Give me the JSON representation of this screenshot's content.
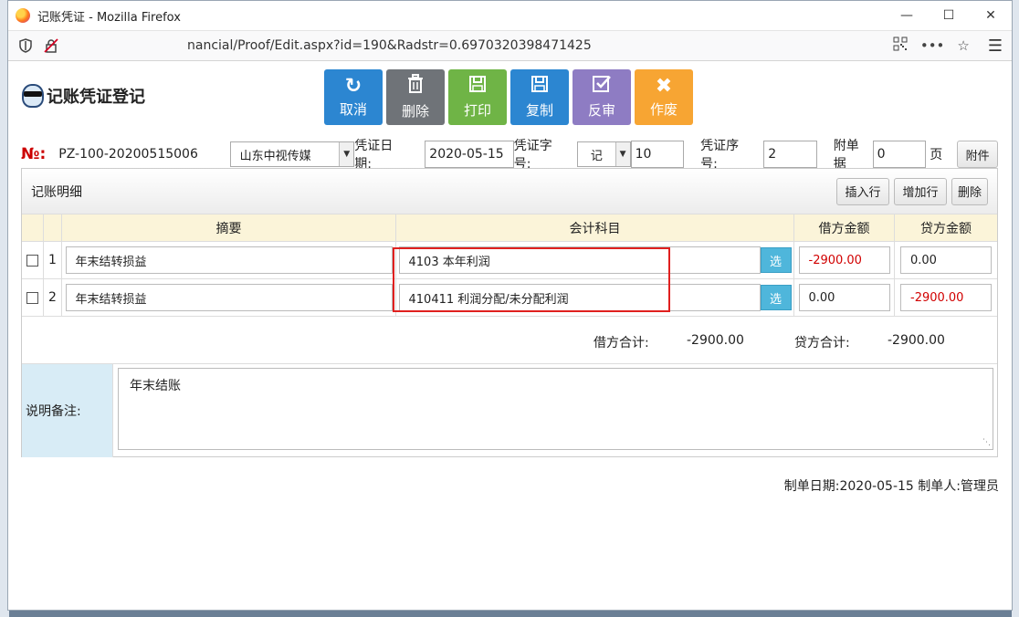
{
  "window": {
    "title": "记账凭证 - Mozilla Firefox",
    "url": "nancial/Proof/Edit.aspx?id=190&Radstr=0.6970320398471425"
  },
  "page": {
    "title": "记账凭证登记",
    "toolbar": {
      "cancel": "取消",
      "delete": "删除",
      "print": "打印",
      "copy": "复制",
      "unaudit": "反审",
      "void": "作废"
    },
    "no_mark": "№:",
    "voucher_no": "PZ-100-20200515006",
    "company": "山东中视传媒",
    "date_label": "凭证日期:",
    "date_value": "2020-05-15",
    "word_label": "凭证字号:",
    "word_value": "记",
    "word_num": "10",
    "seq_label": "凭证序号:",
    "seq_value": "2",
    "attach_label": "附单据",
    "attach_value": "0",
    "attach_unit": "页",
    "attach_button": "附件"
  },
  "detail": {
    "title": "记账明细",
    "insert_row": "插入行",
    "add_row": "增加行",
    "delete": "删除",
    "headers": {
      "summary": "摘要",
      "subject": "会计科目",
      "debit": "借方金额",
      "credit": "贷方金额"
    },
    "select_label": "选",
    "rows": [
      {
        "no": "1",
        "summary": "年末结转损益",
        "subject": "4103 本年利润",
        "debit": "-2900.00",
        "credit": "0.00"
      },
      {
        "no": "2",
        "summary": "年末结转损益",
        "subject": "410411 利润分配/未分配利润",
        "debit": "0.00",
        "credit": "-2900.00"
      }
    ],
    "debit_total_label": "借方合计:",
    "debit_total": "-2900.00",
    "credit_total_label": "贷方合计:",
    "credit_total": "-2900.00",
    "memo_label": "说明备注:",
    "memo": "年末结账"
  },
  "footer": {
    "text": "制单日期:2020-05-15 制单人:管理员"
  }
}
